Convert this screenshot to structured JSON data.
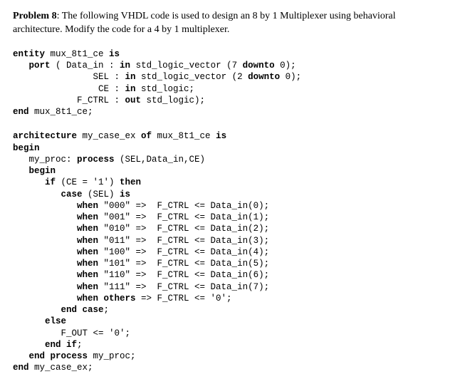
{
  "problem": {
    "number": "Problem  8",
    "text": ":   The following VHDL code  is used to design an 8 by 1 Multiplexer using behavioral architecture. Modify the code for a 4 by 1 multiplexer."
  },
  "code": {
    "l01a": "entity",
    "l01b": " mux_8t1_ce ",
    "l01c": "is",
    "l02a": "   port",
    "l02b": " ( Data_in : ",
    "l02c": "in",
    "l02d": " std_logic_vector (7 ",
    "l02e": "downto",
    "l02f": " 0);",
    "l03a": "               SEL : ",
    "l03b": "in",
    "l03c": " std_logic_vector (2 ",
    "l03d": "downto",
    "l03e": " 0);",
    "l04a": "                CE : ",
    "l04b": "in",
    "l04c": " std_logic;",
    "l05a": "            F_CTRL : ",
    "l05b": "out",
    "l05c": " std_logic);",
    "l06a": "end",
    "l06b": " mux_8t1_ce;",
    "l07a": "architecture",
    "l07b": " my_case_ex ",
    "l07c": "of",
    "l07d": " mux_8t1_ce ",
    "l07e": "is",
    "l08a": "begin",
    "l09a": "   my_proc: ",
    "l09b": "process",
    "l09c": " (SEL,Data_in,CE)",
    "l10a": "   begin",
    "l11a": "      if",
    "l11b": " (CE = '1') ",
    "l11c": "then",
    "l12a": "         case",
    "l12b": " (SEL) ",
    "l12c": "is",
    "l13a": "            when",
    "l13b": " \"000\" =>  F_CTRL <= Data_in(0);",
    "l14a": "            when",
    "l14b": " \"001\" =>  F_CTRL <= Data_in(1);",
    "l15a": "            when",
    "l15b": " \"010\" =>  F_CTRL <= Data_in(2);",
    "l16a": "            when",
    "l16b": " \"011\" =>  F_CTRL <= Data_in(3);",
    "l17a": "            when",
    "l17b": " \"100\" =>  F_CTRL <= Data_in(4);",
    "l18a": "            when",
    "l18b": " \"101\" =>  F_CTRL <= Data_in(5);",
    "l19a": "            when",
    "l19b": " \"110\" =>  F_CTRL <= Data_in(6);",
    "l20a": "            when",
    "l20b": " \"111\" =>  F_CTRL <= Data_in(7);",
    "l21a": "            when others",
    "l21b": " => F_CTRL <= '0';",
    "l22a": "         end case",
    "l22b": ";",
    "l23a": "      else",
    "l24a": "         F_OUT <= '0';",
    "l25a": "      end if",
    "l25b": ";",
    "l26a": "   end process",
    "l26b": " my_proc;",
    "l27a": "end",
    "l27b": " my_case_ex;"
  }
}
